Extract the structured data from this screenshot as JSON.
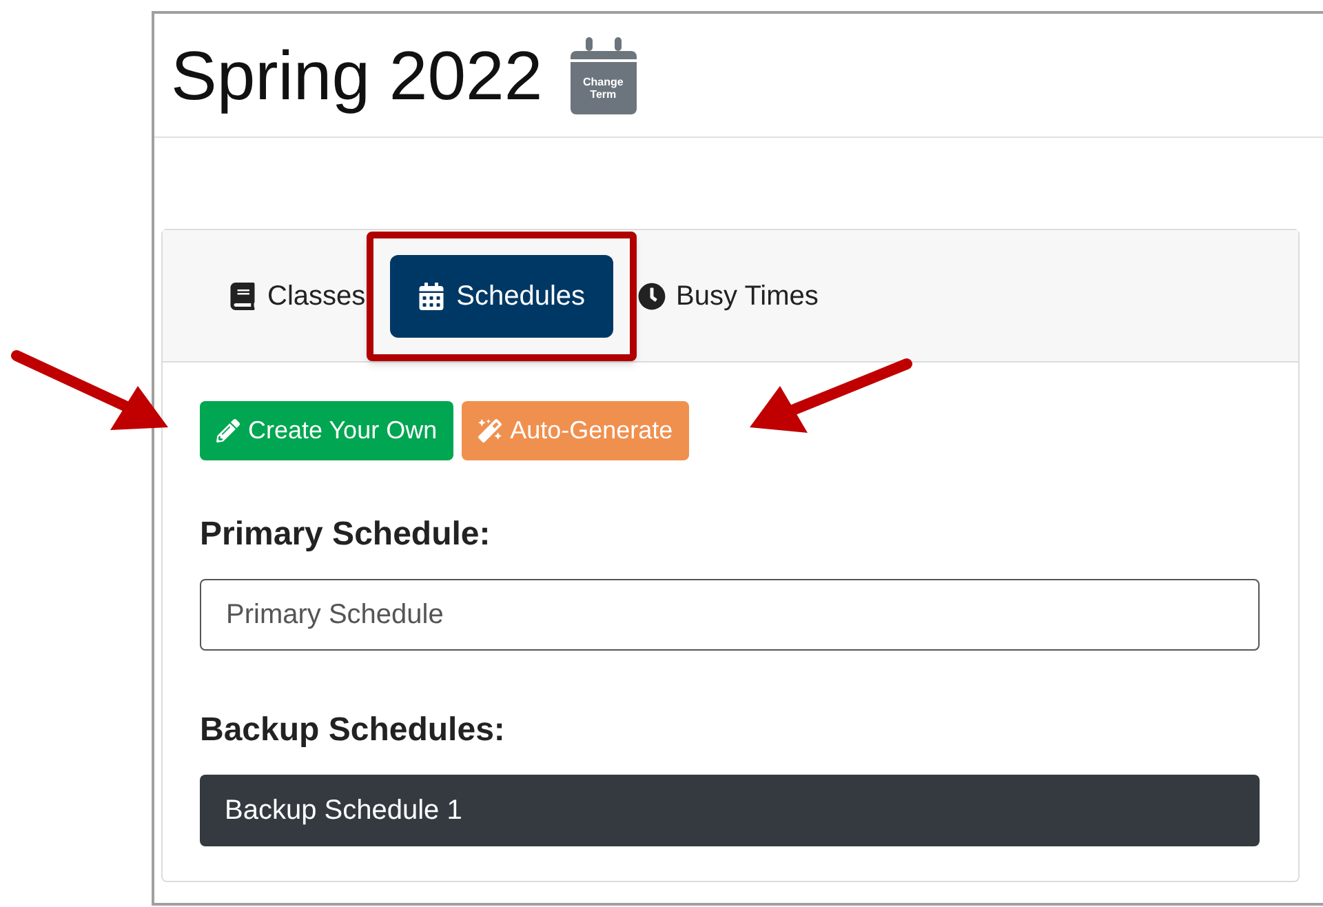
{
  "term": {
    "title": "Spring 2022",
    "change_button": "Change Term"
  },
  "tabs": [
    {
      "label": "Classes",
      "kind": "book",
      "selected": false,
      "highlighted": false
    },
    {
      "label": "Schedules",
      "kind": "calendar",
      "selected": true,
      "highlighted": true
    },
    {
      "label": "Busy Times",
      "kind": "clock",
      "selected": false,
      "highlighted": false
    }
  ],
  "actions": [
    {
      "label": "Create Your Own",
      "kind": "create",
      "annotated": true
    },
    {
      "label": "Auto-Generate",
      "kind": "generate",
      "annotated": true
    }
  ],
  "primary": {
    "heading": "Primary Schedule:",
    "placeholder": "Primary Schedule"
  },
  "backup": {
    "heading": "Backup Schedules:",
    "items": [
      "Backup Schedule 1"
    ]
  }
}
